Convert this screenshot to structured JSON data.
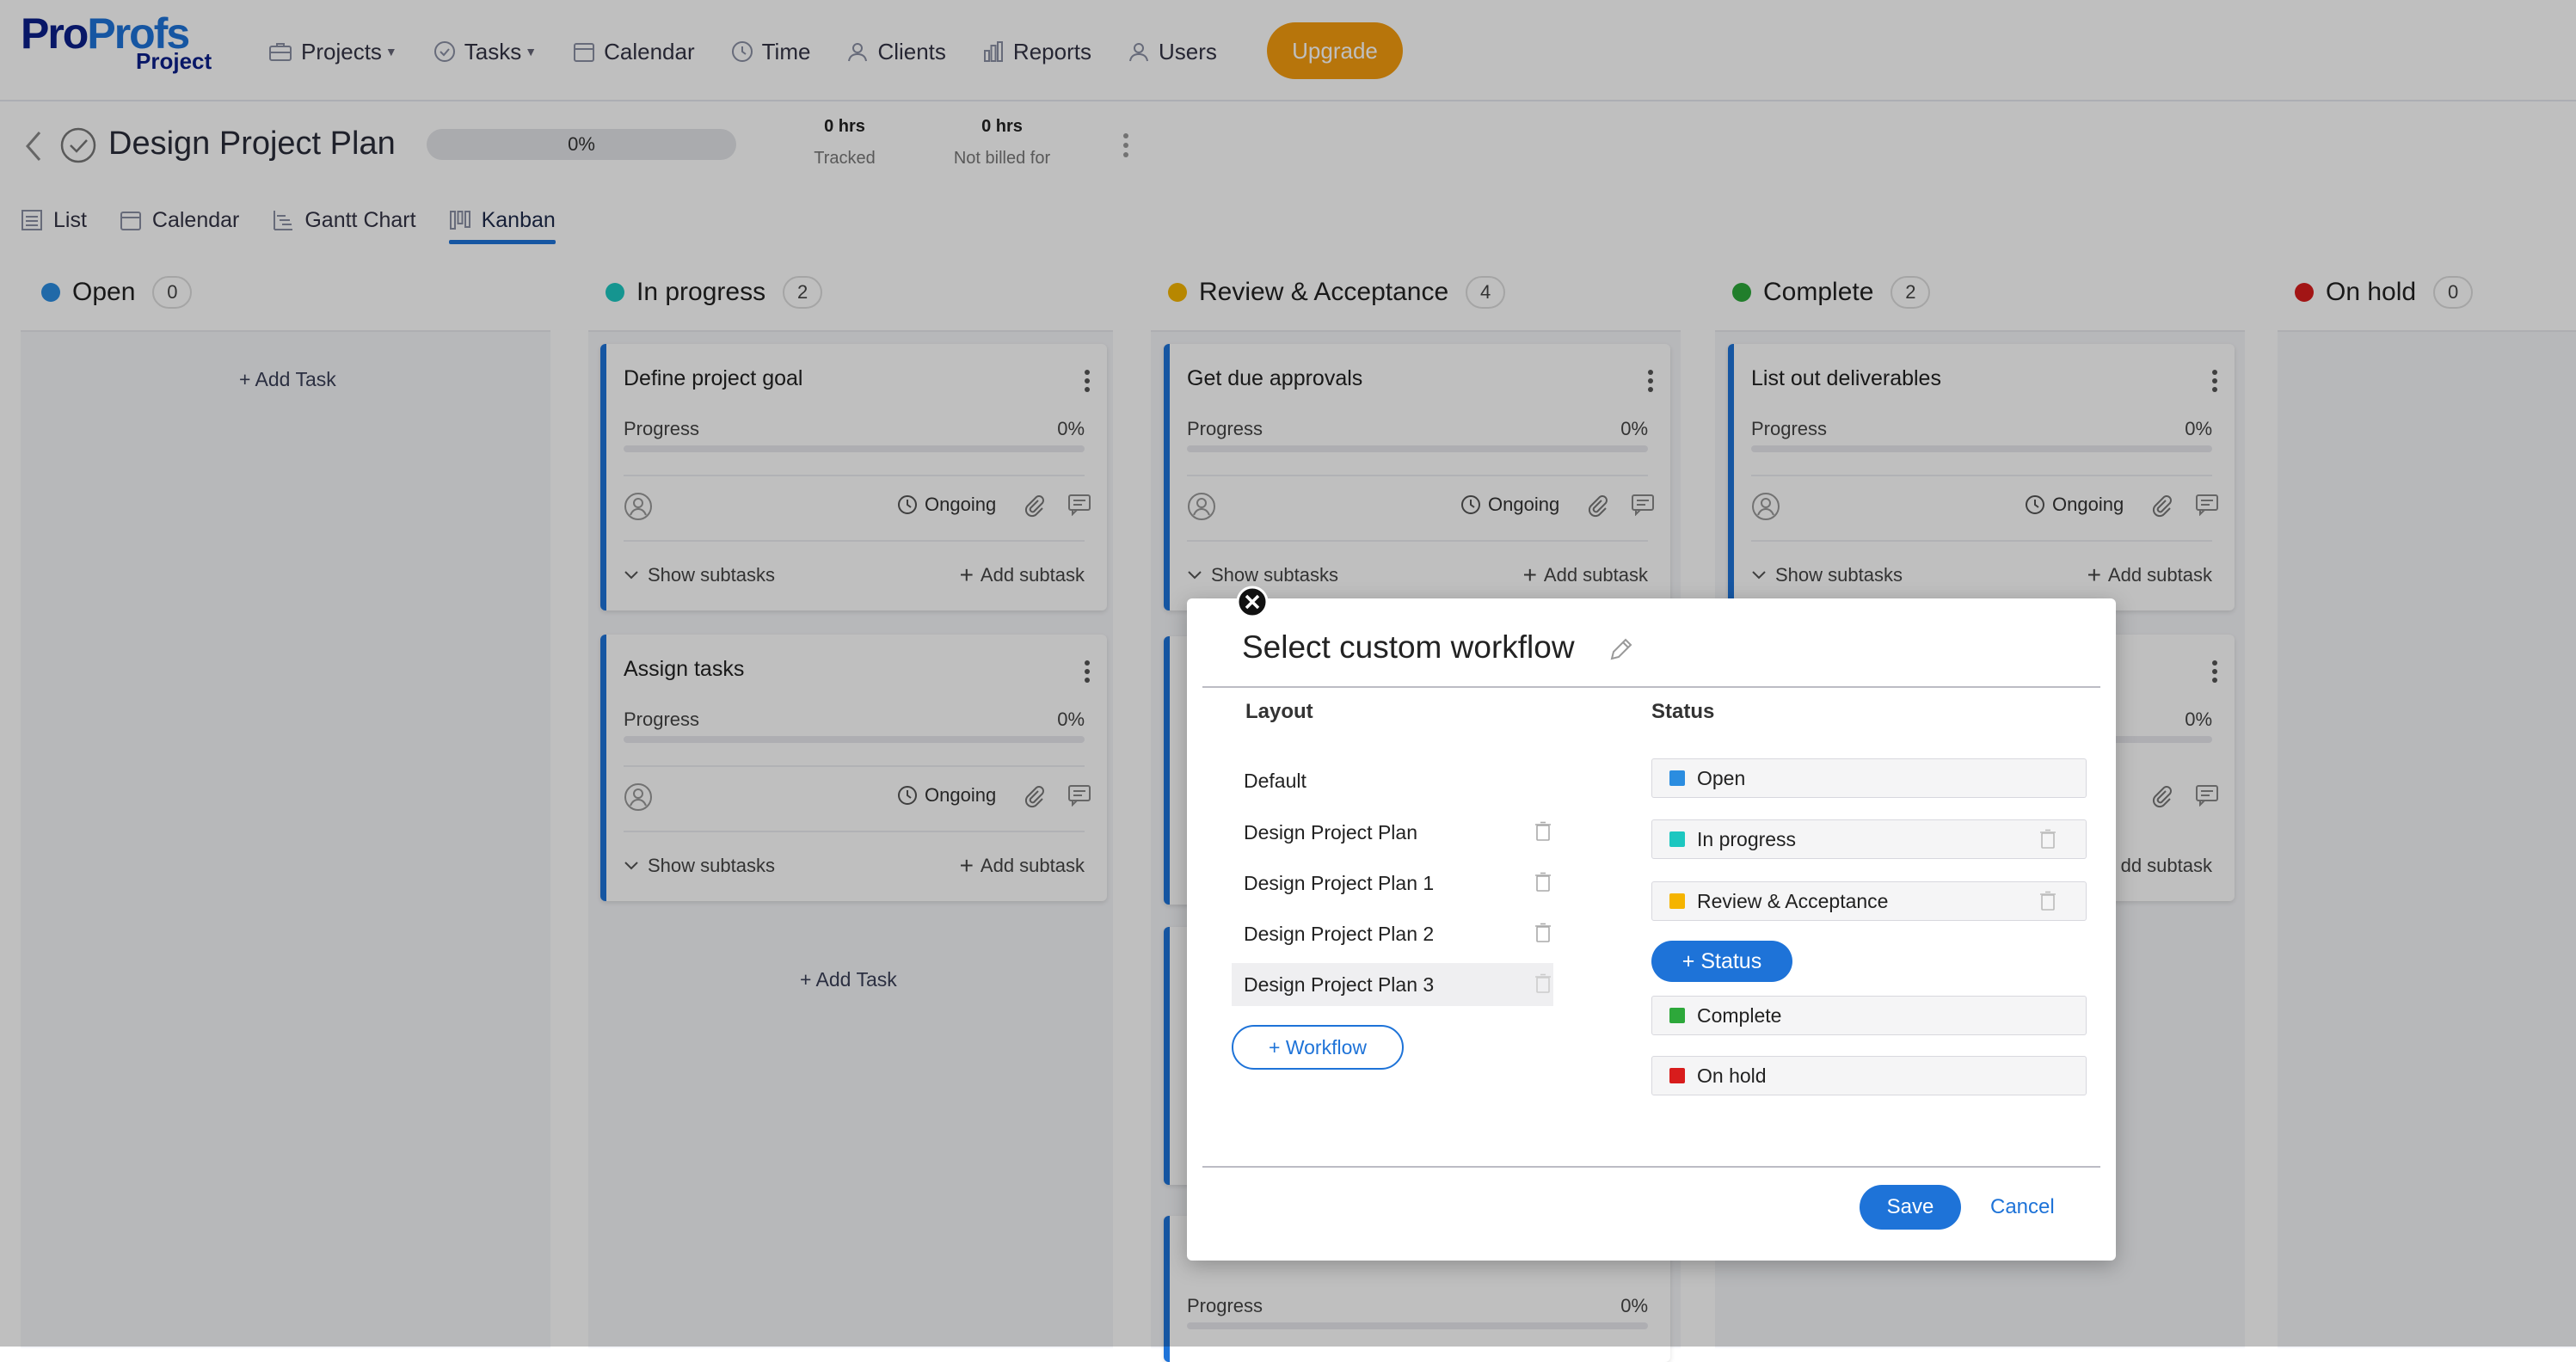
{
  "brand": {
    "logo_pro": "Pro",
    "logo_profs": "Profs",
    "logo_sub": "Project"
  },
  "nav": {
    "items": [
      {
        "label": "Projects",
        "icon": "briefcase-icon",
        "caret": true
      },
      {
        "label": "Tasks",
        "icon": "check-circle-icon",
        "caret": true
      },
      {
        "label": "Calendar",
        "icon": "calendar-icon"
      },
      {
        "label": "Time",
        "icon": "clock-icon"
      },
      {
        "label": "Clients",
        "icon": "user-icon"
      },
      {
        "label": "Reports",
        "icon": "bar-chart-icon"
      },
      {
        "label": "Users",
        "icon": "user-icon"
      }
    ],
    "upgrade": "Upgrade"
  },
  "project": {
    "title": "Design Project Plan",
    "progress": "0%",
    "tracked_value": "0 hrs",
    "tracked_label": "Tracked",
    "notbilled_value": "0 hrs",
    "notbilled_label": "Not billed for"
  },
  "views": {
    "tabs": [
      "List",
      "Calendar",
      "Gantt Chart",
      "Kanban"
    ],
    "active": "Kanban"
  },
  "board": {
    "add_task": "+ Add Task",
    "columns": [
      {
        "name": "Open",
        "count": "0",
        "color": "#2b8de0"
      },
      {
        "name": "In progress",
        "count": "2",
        "color": "#1cc7c0"
      },
      {
        "name": "Review & Acceptance",
        "count": "4",
        "color": "#f5b400"
      },
      {
        "name": "Complete",
        "count": "2",
        "color": "#2da83a"
      },
      {
        "name": "On hold",
        "count": "0",
        "color": "#d81c1c"
      }
    ],
    "cards": {
      "define": {
        "title": "Define project goal",
        "progress_label": "Progress",
        "progress": "0%",
        "status": "Ongoing",
        "show": "Show subtasks",
        "add": "Add subtask"
      },
      "assign": {
        "title": "Assign tasks",
        "progress_label": "Progress",
        "progress": "0%",
        "status": "Ongoing",
        "show": "Show subtasks",
        "add": "Add subtask"
      },
      "approvals": {
        "title": "Get due approvals",
        "progress_label": "Progress",
        "progress": "0%",
        "status": "Ongoing",
        "show": "Show subtasks",
        "add": "Add subtask"
      },
      "deliverables": {
        "title": "List out deliverables",
        "progress_label": "Progress",
        "progress": "0%",
        "status": "Ongoing",
        "show": "Show subtasks",
        "add": "Add subtask"
      },
      "complete2": {
        "progress": "0%",
        "add": "dd subtask"
      },
      "review_bottom": {
        "progress_label": "Progress",
        "progress": "0%"
      }
    }
  },
  "modal": {
    "title": "Select custom workflow",
    "layout_header": "Layout",
    "status_header": "Status",
    "layouts": [
      "Default",
      "Design Project Plan",
      "Design Project Plan 1",
      "Design Project Plan 2",
      "Design Project Plan 3"
    ],
    "selected_layout": "Design Project Plan 3",
    "add_workflow": "+ Workflow",
    "statuses": [
      {
        "name": "Open",
        "color": "#2b8de0"
      },
      {
        "name": "In progress",
        "color": "#1cc7c0"
      },
      {
        "name": "Review & Acceptance",
        "color": "#f5b400"
      },
      {
        "name": "Complete",
        "color": "#2da83a"
      },
      {
        "name": "On hold",
        "color": "#d81c1c"
      }
    ],
    "add_status": "+ Status",
    "save": "Save",
    "cancel": "Cancel"
  }
}
